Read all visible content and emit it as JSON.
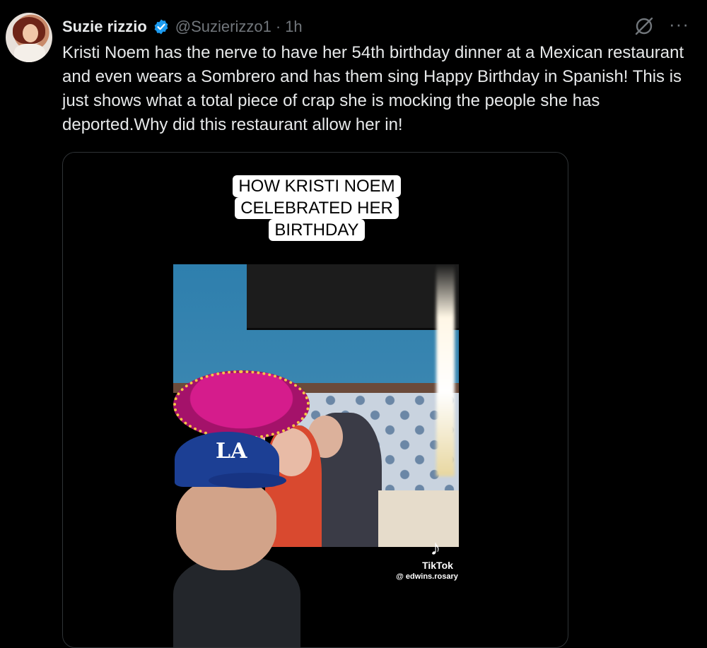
{
  "tweet": {
    "author_name": "Suzie rizzio",
    "handle": "@Suzierizzo1",
    "separator": "·",
    "time": "1h",
    "text": "Kristi Noem has the nerve to have her 54th birthday dinner at a Mexican restaurant and even wears a Sombrero and has them sing Happy Birthday in Spanish! This is just shows what a total piece of crap she is mocking the people she has deported.Why did this restaurant allow her in!",
    "more_label": "···"
  },
  "media": {
    "caption_lines": [
      "HOW KRISTI NOEM",
      "CELEBRATED HER",
      "BIRTHDAY"
    ],
    "tiktok_label": "TikTok",
    "tiktok_user": "@ edwins.rosary",
    "cap_logo": "LA"
  },
  "colors": {
    "background": "#000000",
    "text": "#e7e9ea",
    "muted": "#71767b",
    "verified": "#1d9bf0",
    "border": "#2f3336"
  },
  "icons": [
    "avatar",
    "verified-badge-icon",
    "grok-icon",
    "more-icon",
    "tiktok-icon"
  ]
}
